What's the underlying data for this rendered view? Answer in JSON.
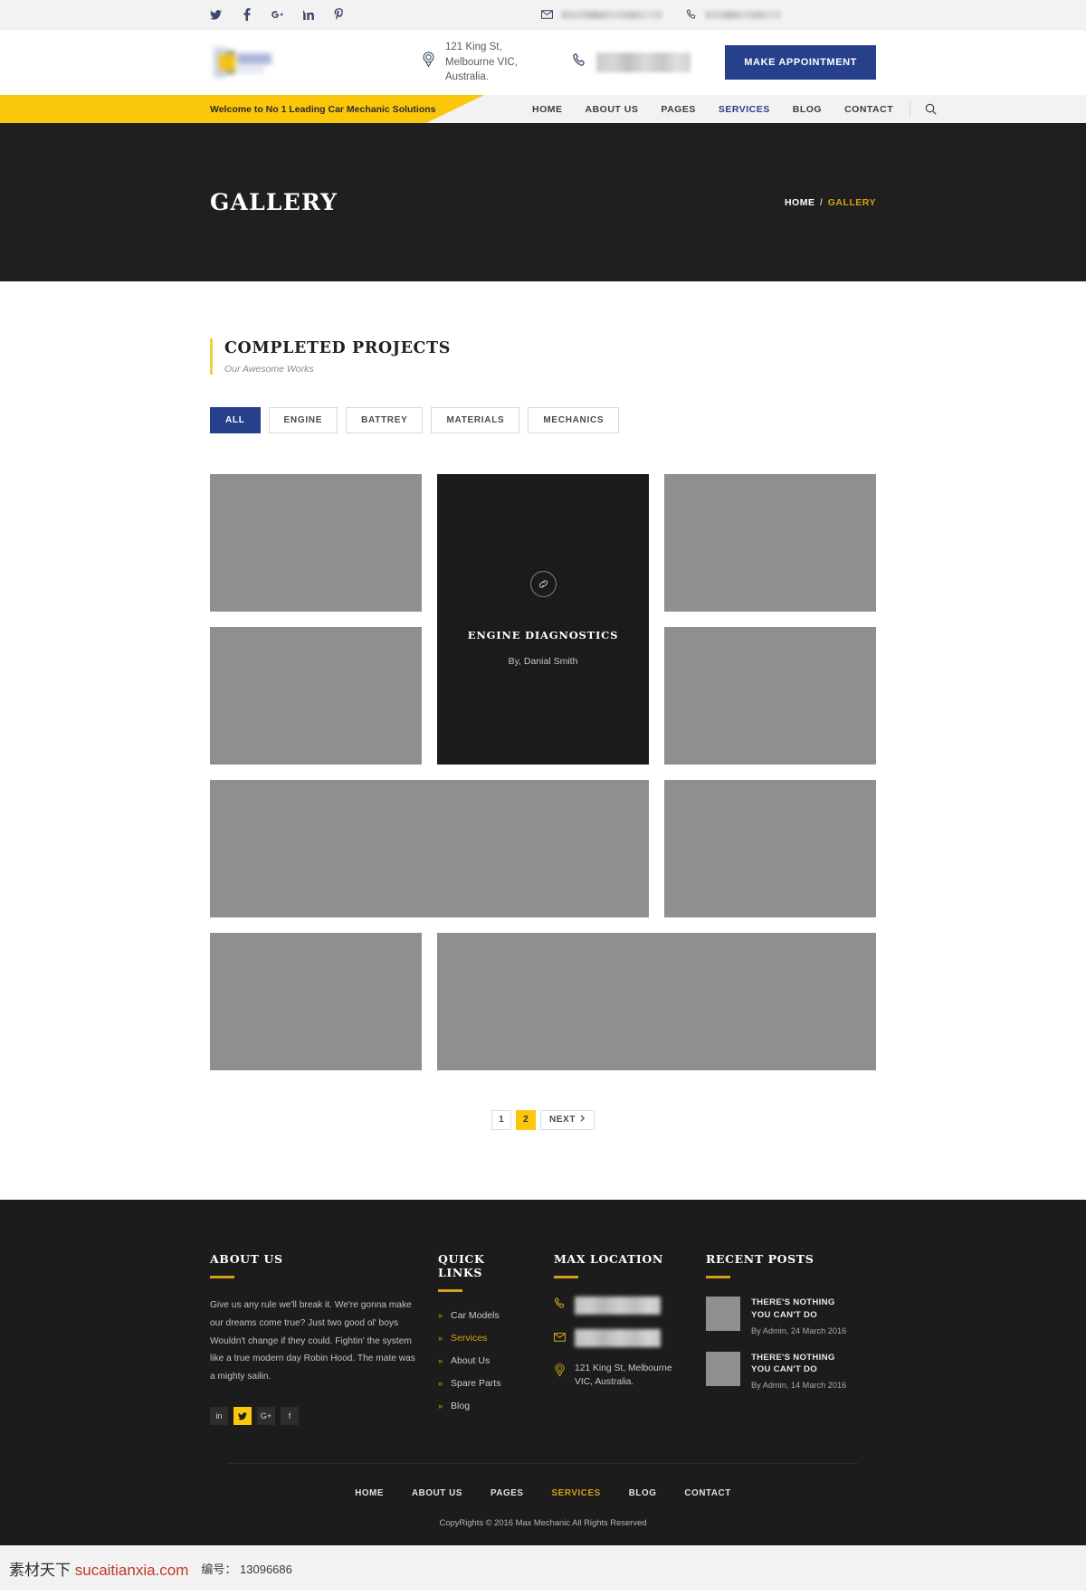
{
  "topbar": {
    "socials": [
      {
        "name": "twitter-icon",
        "label": "Twitter"
      },
      {
        "name": "facebook-icon",
        "label": "Facebook"
      },
      {
        "name": "google-plus-icon",
        "label": "Google Plus"
      },
      {
        "name": "linkedin-icon",
        "label": "LinkedIn"
      },
      {
        "name": "pinterest-icon",
        "label": "Pinterest"
      }
    ],
    "email_label": "",
    "phone_label": ""
  },
  "header": {
    "logo_alt": "Max Mechanic",
    "address": "121 King St, Melbourne VIC, Australia.",
    "phone_label": "",
    "appointment_button": "MAKE APPOINTMENT"
  },
  "nav": {
    "welcome": "Welcome to No 1 Leading Car Mechanic Solutions",
    "items": [
      {
        "label": "HOME",
        "active": false
      },
      {
        "label": "ABOUT US",
        "active": false
      },
      {
        "label": "PAGES",
        "active": false
      },
      {
        "label": "SERVICES",
        "active": true
      },
      {
        "label": "BLOG",
        "active": false
      },
      {
        "label": "CONTACT",
        "active": false
      }
    ]
  },
  "banner": {
    "title": "GALLERY",
    "breadcrumb_home": "HOME",
    "breadcrumb_sep": "/",
    "breadcrumb_current": "GALLERY"
  },
  "section": {
    "title": "COMPLETED PROJECTS",
    "subtitle": "Our Awesome Works"
  },
  "filters": [
    {
      "label": "ALL",
      "active": true
    },
    {
      "label": "ENGINE",
      "active": false
    },
    {
      "label": "BATTREY",
      "active": false
    },
    {
      "label": "MATERIALS",
      "active": false
    },
    {
      "label": "MECHANICS",
      "active": false
    }
  ],
  "gallery": {
    "overlay": {
      "title": "ENGINE DIAGNOSTICS",
      "by": "By, Danial Smith",
      "icon": "link-icon"
    }
  },
  "pagination": {
    "page1": "1",
    "page2": "2",
    "next": "NEXT",
    "active_page": "2"
  },
  "footer": {
    "about": {
      "heading": "ABOUT US",
      "text": "Give us any rule we'll break it. We're gonna make our dreams come true? Just two good ol' boys Wouldn't change if they could. Fightin' the system like a true modern day Robin Hood. The mate was a mighty sailin.",
      "socials": [
        {
          "name": "linkedin-icon",
          "label": "in",
          "highlight": false
        },
        {
          "name": "twitter-icon",
          "label": "t",
          "highlight": true
        },
        {
          "name": "google-plus-icon",
          "label": "G+",
          "highlight": false
        },
        {
          "name": "facebook-icon",
          "label": "f",
          "highlight": false
        }
      ]
    },
    "quick_links": {
      "heading": "QUICK LINKS",
      "items": [
        {
          "label": "Car Models",
          "active": false
        },
        {
          "label": "Services",
          "active": true
        },
        {
          "label": "About Us",
          "active": false
        },
        {
          "label": "Spare Parts",
          "active": false
        },
        {
          "label": "Blog",
          "active": false
        }
      ]
    },
    "location": {
      "heading": "MAX LOCATION",
      "phone": "",
      "email": "",
      "address": "121 King St, Melbourne VIC, Australia."
    },
    "recent_posts": {
      "heading": "RECENT POSTS",
      "items": [
        {
          "title": "THERE'S NOTHING YOU CAN'T DO",
          "meta": "By Admin,  24 March 2016"
        },
        {
          "title": "THERE'S NOTHING YOU CAN'T DO",
          "meta": "By Admin,  14 March 2016"
        }
      ]
    },
    "bottom_nav": [
      {
        "label": "HOME",
        "active": false
      },
      {
        "label": "ABOUT US",
        "active": false
      },
      {
        "label": "PAGES",
        "active": false
      },
      {
        "label": "SERVICES",
        "active": true
      },
      {
        "label": "BLOG",
        "active": false
      },
      {
        "label": "CONTACT",
        "active": false
      }
    ],
    "copyright": "CopyRights © 2016 Max Mechanic All Rights Reserved"
  },
  "watermark": {
    "brand_a": "素材天下 ",
    "brand_b": "sucaitianxia.com",
    "meta": "编号： 13096686"
  },
  "colors": {
    "accent_yellow": "#fbc70b",
    "accent_gold": "#d4a017",
    "accent_blue": "#27408b",
    "dark": "#1c1c1c"
  }
}
